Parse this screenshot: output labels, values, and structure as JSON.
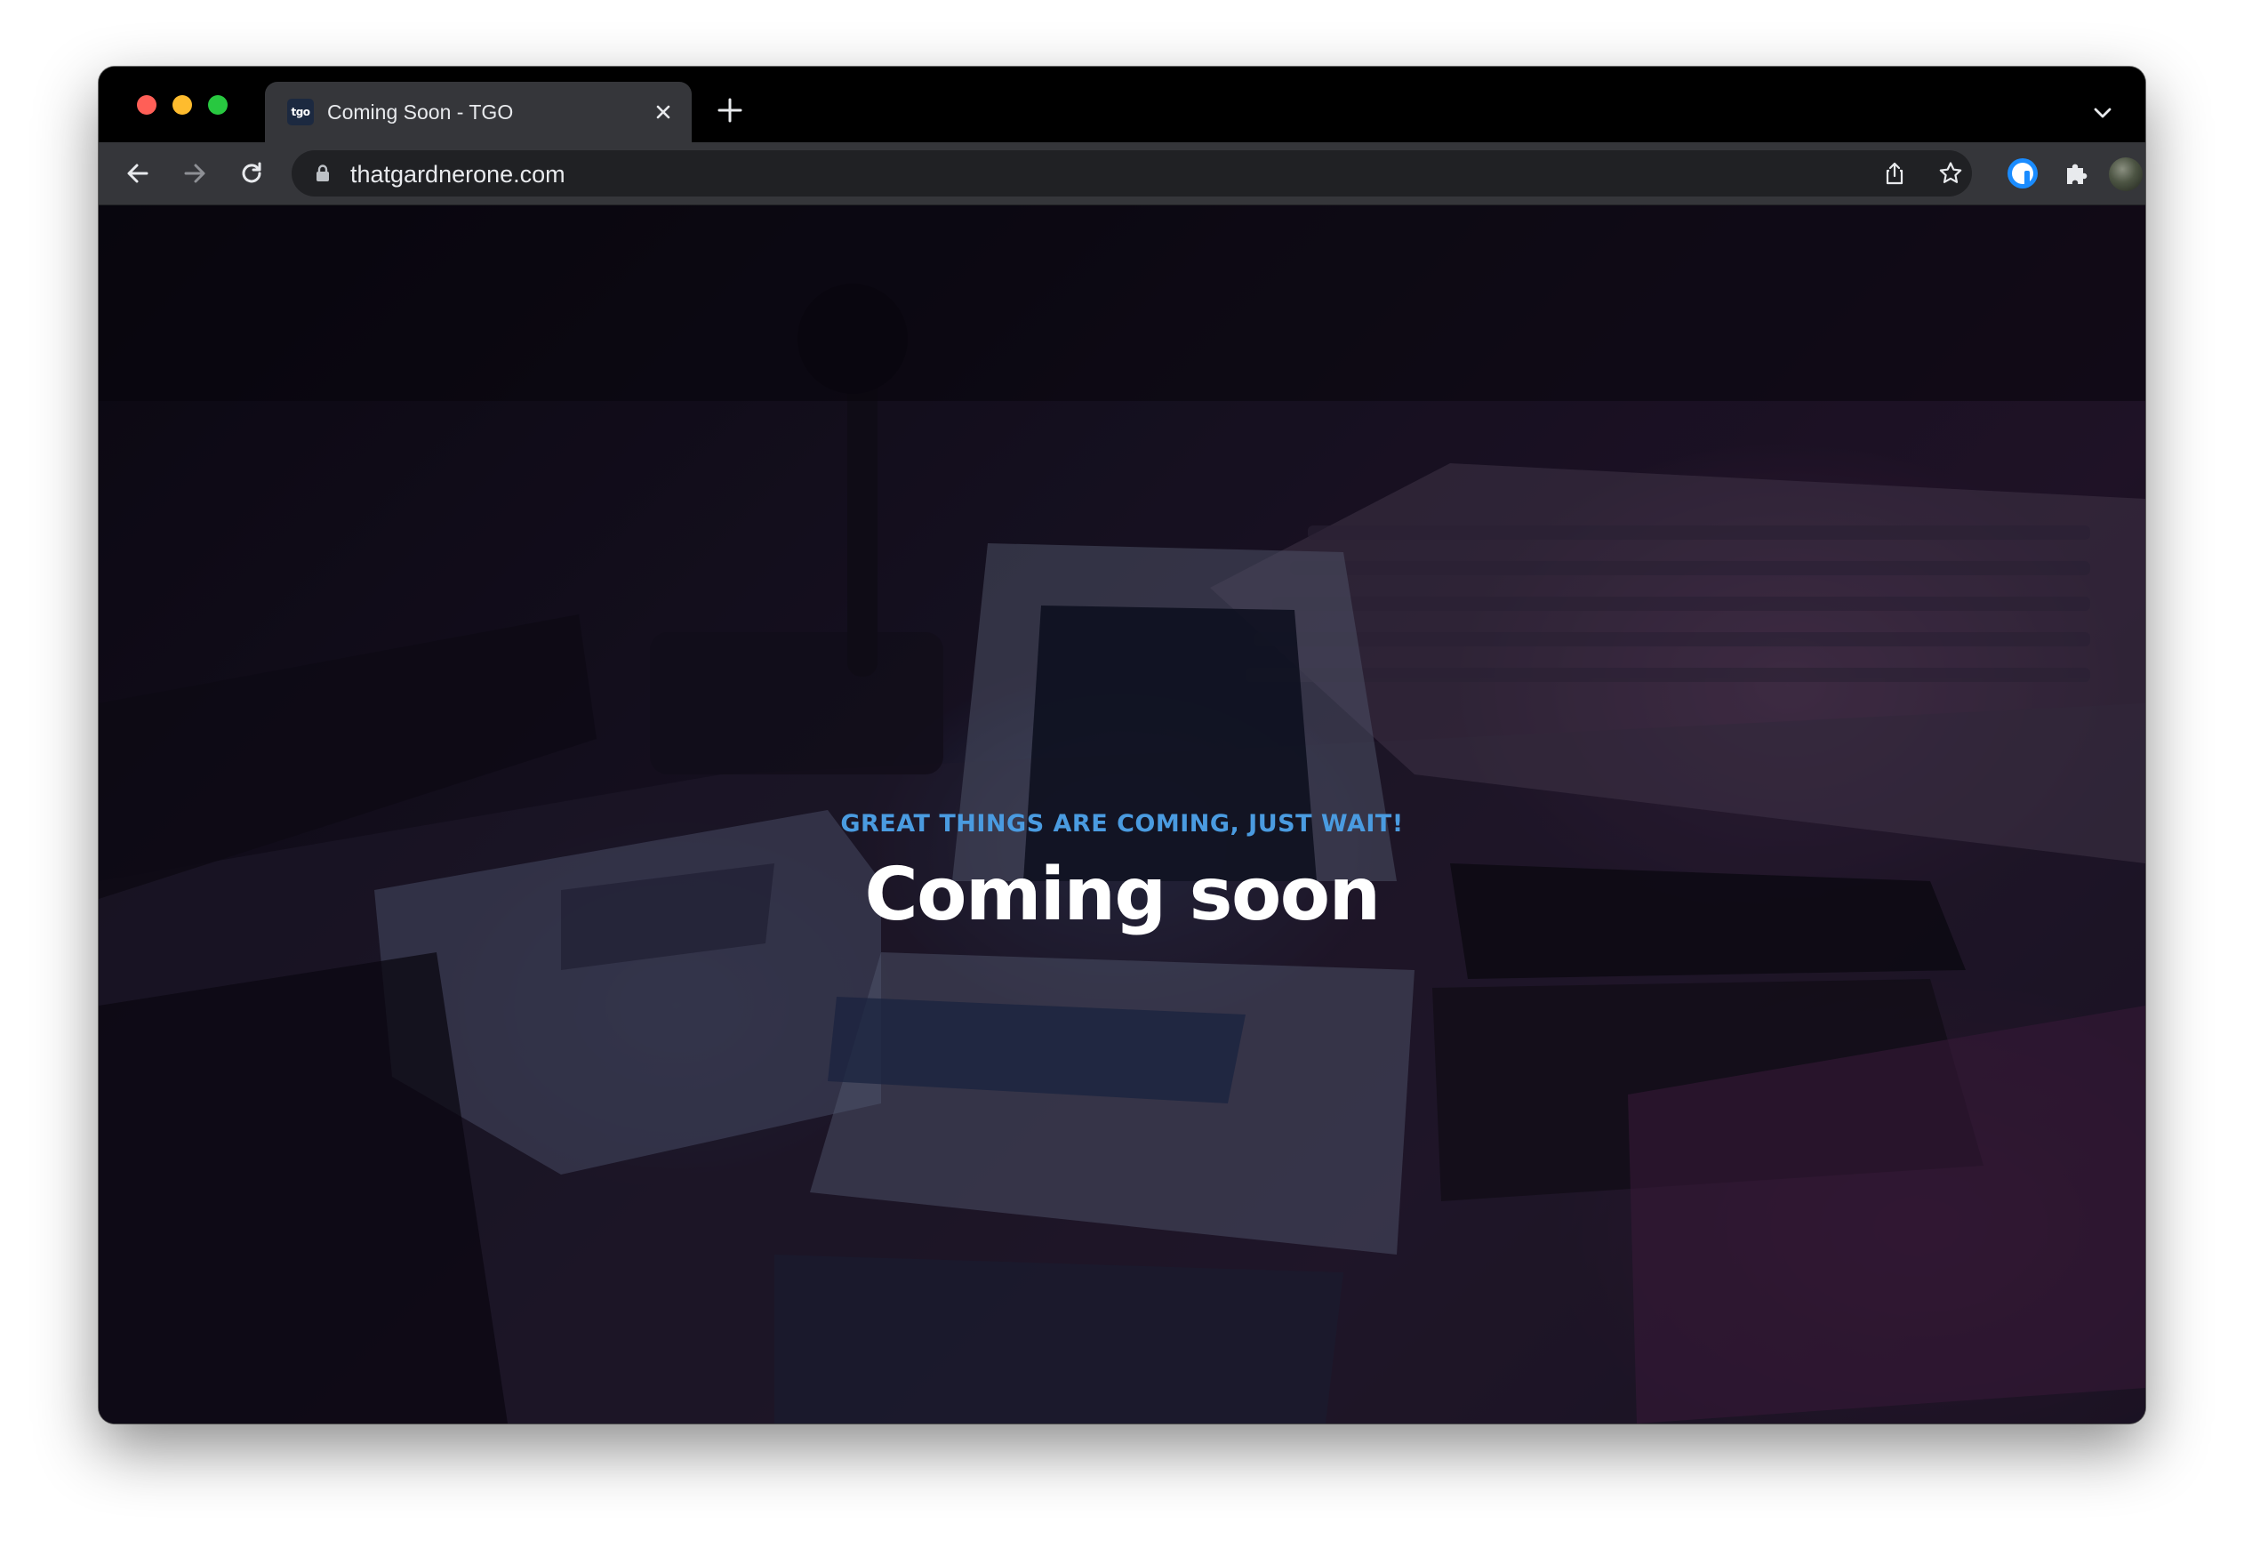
{
  "browser": {
    "tab": {
      "favicon_text": "tgo",
      "title": "Coming Soon - TGO"
    },
    "address_bar": {
      "url": "thatgardnerone.com"
    },
    "icons": {
      "back": "arrow-left-icon",
      "forward": "arrow-right-icon",
      "reload": "reload-icon",
      "lock": "lock-icon",
      "share": "share-icon",
      "bookmark": "star-icon",
      "password_manager": "1password-icon",
      "extensions": "puzzle-icon",
      "profile": "avatar",
      "menu": "kebab-menu-icon",
      "new_tab": "plus-icon",
      "close_tab": "close-icon",
      "tab_search": "chevron-down-icon"
    },
    "colors": {
      "traffic_red": "#ff5f57",
      "traffic_yellow": "#febc2e",
      "traffic_green": "#28c840",
      "toolbar": "#35363a",
      "omnibox": "#202124"
    }
  },
  "page": {
    "kicker": "GREAT THINGS ARE COMING, JUST WAIT!",
    "headline": "Coming soon",
    "colors": {
      "kicker": "#4a9be0",
      "headline": "#ffffff"
    }
  }
}
